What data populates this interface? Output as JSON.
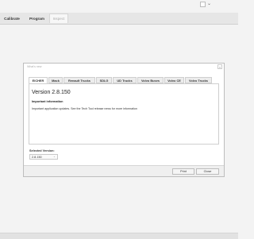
{
  "toolbar": {
    "tabs": [
      "Calibrate",
      "Program",
      "Inspect"
    ]
  },
  "dialog": {
    "title": "What's new",
    "close_glyph": "×",
    "tabs": [
      "EICHER",
      "Mack",
      "Renault Trucks",
      "SDLG",
      "UD Trucks",
      "Volvo Buses",
      "Volvo CE",
      "Volvo Trucks"
    ],
    "version_title": "Version 2.8.150",
    "info_heading": "Important information",
    "info_text": "Important application updates. See the Tech Tool release news for more information",
    "selected_version_label": "Selected Version:",
    "selected_version_value": "2.8.150",
    "print_label": "Print",
    "close_label": "Close"
  },
  "icons": {
    "chevron": "⌄"
  }
}
